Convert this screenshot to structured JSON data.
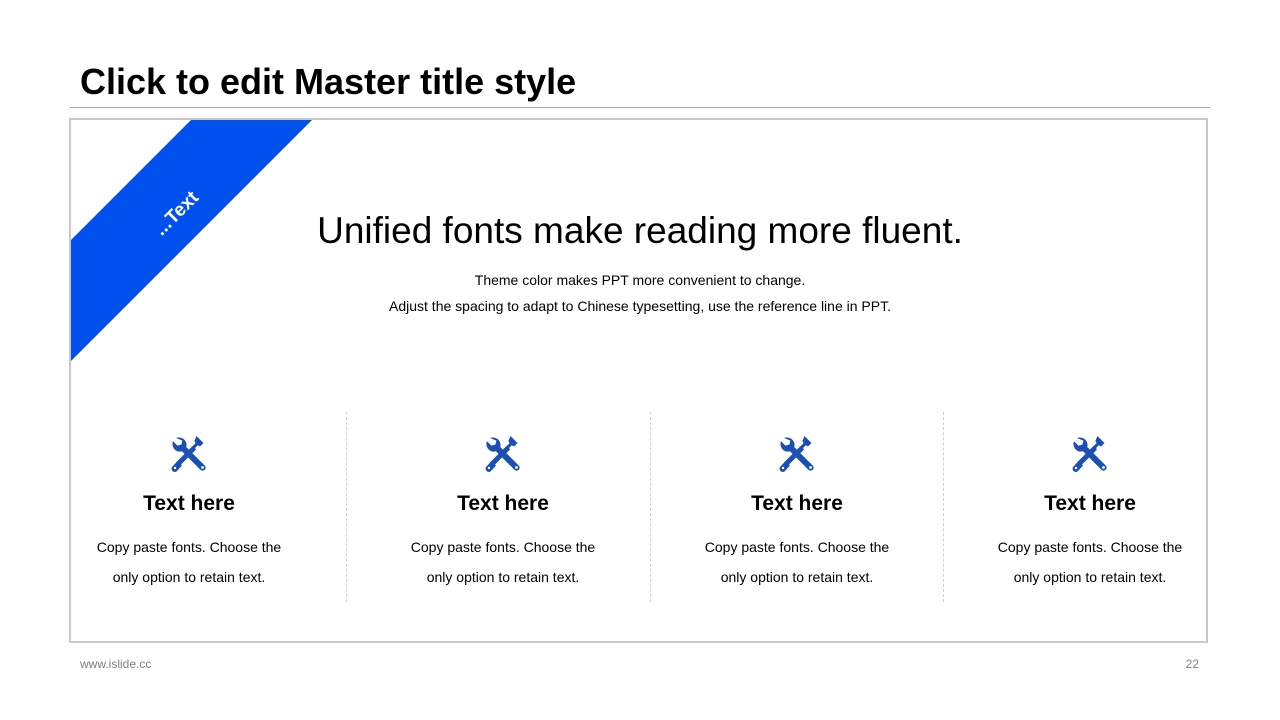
{
  "slide": {
    "master_title": "Click to edit Master title style",
    "ribbon_label": "...Text",
    "headline": "Unified fonts make reading more fluent.",
    "subline_1": "Theme color makes PPT more convenient to change.",
    "subline_2": "Adjust the spacing to adapt to Chinese typesetting, use the reference line in PPT.",
    "features": [
      {
        "icon": "tools-icon",
        "title": "Text here",
        "desc_line_1": "Copy paste fonts. Choose the",
        "desc_line_2": "only option to retain text."
      },
      {
        "icon": "tools-icon",
        "title": "Text here",
        "desc_line_1": "Copy paste fonts. Choose the",
        "desc_line_2": "only option to retain text."
      },
      {
        "icon": "tools-icon",
        "title": "Text here",
        "desc_line_1": "Copy paste fonts. Choose the",
        "desc_line_2": "only option to retain text."
      },
      {
        "icon": "tools-icon",
        "title": "Text here",
        "desc_line_1": "Copy paste fonts. Choose the",
        "desc_line_2": "only option to retain text."
      }
    ],
    "footer_url": "www.islide.cc",
    "page_number": "22"
  },
  "colors": {
    "accent": "#0050f0",
    "icon": "#1a4fb3",
    "frame_border": "#c8c8c8",
    "footer_text": "#808080"
  }
}
